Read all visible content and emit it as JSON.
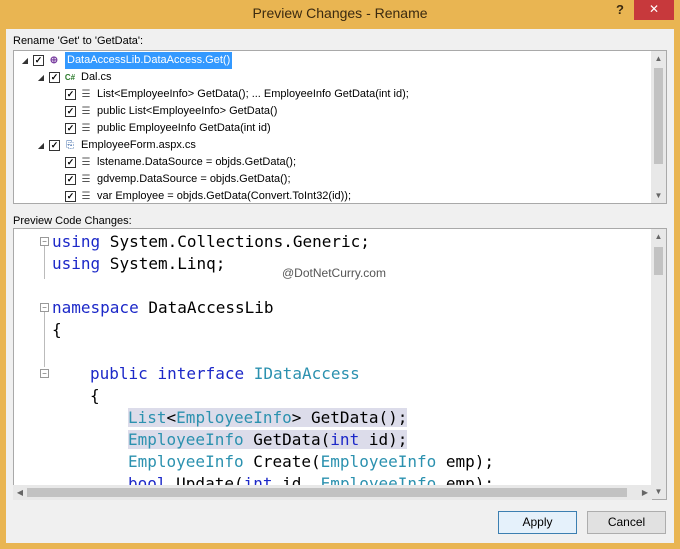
{
  "window": {
    "title": "Preview Changes - Rename",
    "help_label": "?",
    "close_label": "✕"
  },
  "rename_label": "Rename 'Get' to 'GetData':",
  "tree": [
    {
      "level": 0,
      "expander": "◢",
      "checked": true,
      "icon": "interface-icon",
      "icon_glyph": "⊕",
      "label": "DataAccessLib.DataAccess.Get()",
      "selected": true
    },
    {
      "level": 1,
      "expander": "◢",
      "checked": true,
      "icon": "csharp-file-icon",
      "icon_glyph": "C#",
      "label": "Dal.cs",
      "selected": false
    },
    {
      "level": 2,
      "expander": "",
      "checked": true,
      "icon": "code-line-icon",
      "icon_glyph": "☰",
      "label": "List<EmployeeInfo> GetData(); ... EmployeeInfo GetData(int id);",
      "selected": false
    },
    {
      "level": 2,
      "expander": "",
      "checked": true,
      "icon": "code-line-icon",
      "icon_glyph": "☰",
      "label": "public List<EmployeeInfo> GetData()",
      "selected": false
    },
    {
      "level": 2,
      "expander": "",
      "checked": true,
      "icon": "code-line-icon",
      "icon_glyph": "☰",
      "label": "public EmployeeInfo GetData(int id)",
      "selected": false
    },
    {
      "level": 1,
      "expander": "◢",
      "checked": true,
      "icon": "aspx-file-icon",
      "icon_glyph": "⎘",
      "label": "EmployeeForm.aspx.cs",
      "selected": false
    },
    {
      "level": 2,
      "expander": "",
      "checked": true,
      "icon": "code-line-icon",
      "icon_glyph": "☰",
      "label": "lstename.DataSource = objds.GetData();",
      "selected": false
    },
    {
      "level": 2,
      "expander": "",
      "checked": true,
      "icon": "code-line-icon",
      "icon_glyph": "☰",
      "label": "gdvemp.DataSource = objds.GetData();",
      "selected": false
    },
    {
      "level": 2,
      "expander": "",
      "checked": true,
      "icon": "code-line-icon",
      "icon_glyph": "☰",
      "label": "var Employee = objds.GetData(Convert.ToInt32(id));",
      "selected": false
    }
  ],
  "preview_label": "Preview Code Changes:",
  "watermark": "@DotNetCurry.com",
  "code_lines": [
    {
      "fold": "⊟",
      "tokens": [
        {
          "t": "using",
          "c": "kw"
        },
        {
          "t": " System.Collections.Generic;",
          "c": ""
        }
      ],
      "indent": 0,
      "hl": false
    },
    {
      "fold": "",
      "tokens": [
        {
          "t": "using",
          "c": "kw"
        },
        {
          "t": " System.Linq;",
          "c": ""
        }
      ],
      "indent": 0,
      "hl": false
    },
    {
      "fold": "",
      "tokens": [],
      "indent": 0,
      "hl": false
    },
    {
      "fold": "⊟",
      "tokens": [
        {
          "t": "namespace",
          "c": "kw"
        },
        {
          "t": " DataAccessLib",
          "c": ""
        }
      ],
      "indent": 0,
      "hl": false
    },
    {
      "fold": "",
      "tokens": [
        {
          "t": "{",
          "c": ""
        }
      ],
      "indent": 0,
      "hl": false
    },
    {
      "fold": "",
      "tokens": [],
      "indent": 0,
      "hl": false
    },
    {
      "fold": "⊟",
      "tokens": [
        {
          "t": "public",
          "c": "kw"
        },
        {
          "t": " ",
          "c": ""
        },
        {
          "t": "interface",
          "c": "kw"
        },
        {
          "t": " ",
          "c": ""
        },
        {
          "t": "IDataAccess",
          "c": "ty"
        }
      ],
      "indent": 1,
      "hl": false
    },
    {
      "fold": "",
      "tokens": [
        {
          "t": "{",
          "c": ""
        }
      ],
      "indent": 1,
      "hl": false
    },
    {
      "fold": "",
      "tokens": [
        {
          "t": "List",
          "c": "ty"
        },
        {
          "t": "<",
          "c": ""
        },
        {
          "t": "EmployeeInfo",
          "c": "ty"
        },
        {
          "t": "> GetData();",
          "c": ""
        }
      ],
      "indent": 2,
      "hl": true
    },
    {
      "fold": "",
      "tokens": [
        {
          "t": "EmployeeInfo",
          "c": "ty"
        },
        {
          "t": " GetData(",
          "c": ""
        },
        {
          "t": "int",
          "c": "kw"
        },
        {
          "t": " id);",
          "c": ""
        }
      ],
      "indent": 2,
      "hl": true
    },
    {
      "fold": "",
      "tokens": [
        {
          "t": "EmployeeInfo",
          "c": "ty"
        },
        {
          "t": " Create(",
          "c": ""
        },
        {
          "t": "EmployeeInfo",
          "c": "ty"
        },
        {
          "t": " emp);",
          "c": ""
        }
      ],
      "indent": 2,
      "hl": false
    },
    {
      "fold": "",
      "tokens": [
        {
          "t": "bool",
          "c": "kw"
        },
        {
          "t": " Update(",
          "c": ""
        },
        {
          "t": "int",
          "c": "kw"
        },
        {
          "t": " id, ",
          "c": ""
        },
        {
          "t": "EmployeeInfo",
          "c": "ty"
        },
        {
          "t": " emp);",
          "c": ""
        }
      ],
      "indent": 2,
      "hl": false
    }
  ],
  "buttons": {
    "apply": "Apply",
    "cancel": "Cancel"
  }
}
